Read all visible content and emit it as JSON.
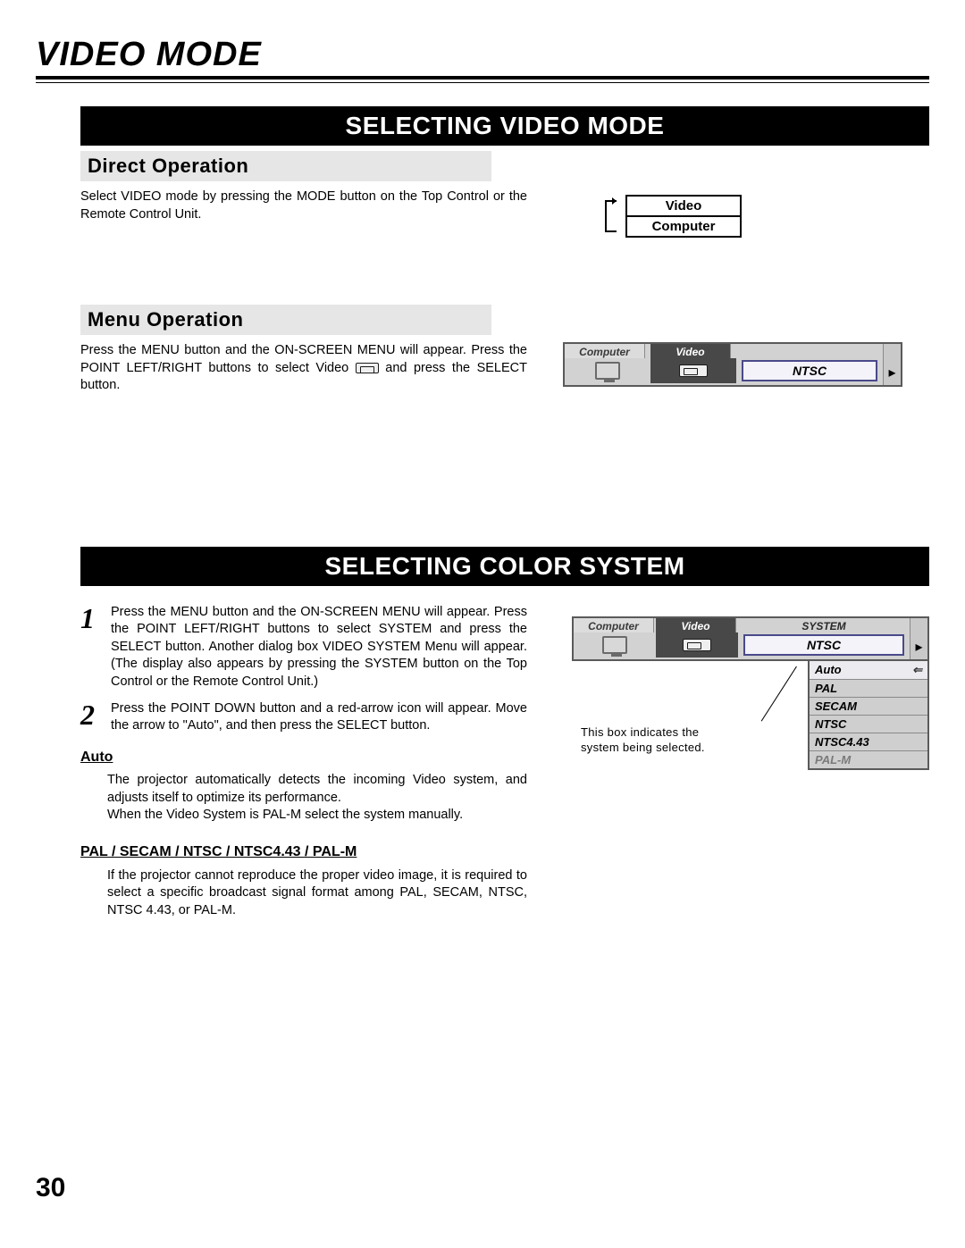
{
  "page_title": "VIDEO MODE",
  "page_number": "30",
  "section1": {
    "blackbar": "SELECTING VIDEO MODE",
    "sub1_title": "Direct Operation",
    "sub1_text": "Select VIDEO mode by pressing the MODE button on the Top Control or the Remote Control Unit.",
    "sub2_title": "Menu Operation",
    "sub2_text_a": "Press the MENU button and the ON-SCREEN MENU will appear. Press the POINT LEFT/RIGHT buttons to select Video ",
    "sub2_text_b": " and press the SELECT button.",
    "diag1": {
      "top": "Video",
      "bottom": "Computer"
    },
    "osd1": {
      "tab_computer": "Computer",
      "tab_video": "Video",
      "ntsc": "NTSC"
    }
  },
  "section2": {
    "blackbar": "SELECTING COLOR SYSTEM",
    "step1": "Press the MENU button and the ON-SCREEN MENU will appear. Press the POINT LEFT/RIGHT buttons to select SYSTEM and press the SELECT button.  Another dialog box VIDEO SYSTEM Menu will appear.  (The display also appears by pressing the SYSTEM button on the Top Control or the Remote Control Unit.)",
    "step2_a": "Press the POINT DOWN button and a red-arrow icon will appear. Move the arrow to \"Auto\", and then press the ",
    "step2_b": "SELECT button.",
    "auto_head": "Auto",
    "auto_text1": "The projector automatically detects the incoming Video system, and adjusts itself to optimize its performance.",
    "auto_text2": "When the Video System is PAL-M select the system manually.",
    "pal_head": "PAL / SECAM / NTSC / NTSC4.43 / PAL-M",
    "pal_text": "If the projector cannot reproduce the proper video image, it is required to select a specific broadcast signal format among PAL, SECAM, NTSC, NTSC 4.43, or PAL-M.",
    "osd2": {
      "tab_computer": "Computer",
      "tab_video": "Video",
      "tab_system": "SYSTEM",
      "ntsc": "NTSC",
      "list": [
        "Auto",
        "PAL",
        "SECAM",
        "NTSC",
        "NTSC4.43",
        "PAL-M"
      ],
      "selected_index": 0,
      "annot": "This box indicates the system being selected."
    }
  }
}
